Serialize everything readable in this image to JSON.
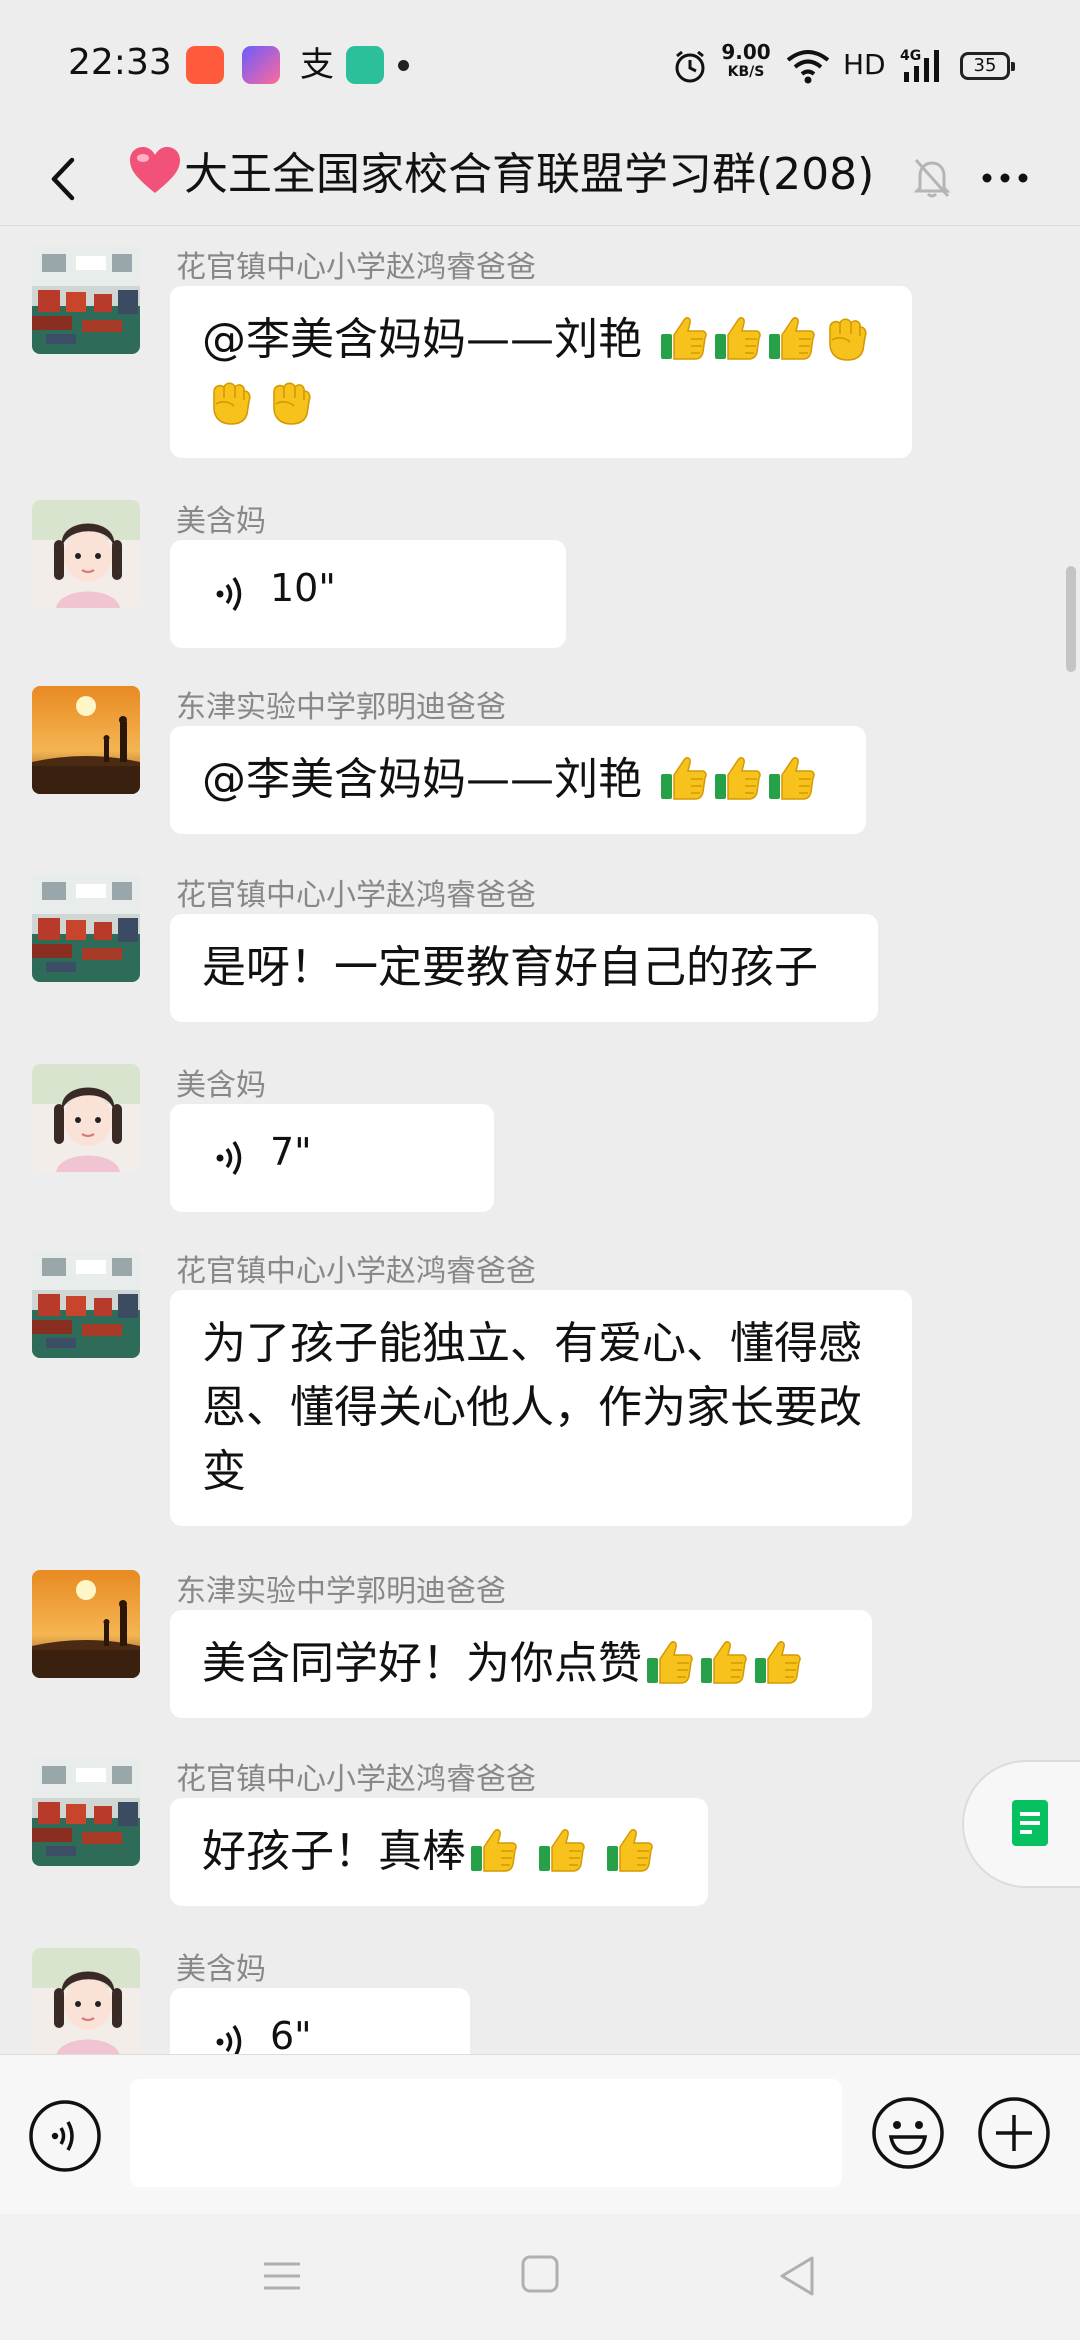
{
  "status_bar": {
    "time": "22:33",
    "net_speed": "9.00",
    "net_unit": "KB/S",
    "hd": "HD",
    "battery": "35"
  },
  "header": {
    "title": "大王全国家校合育联盟学习群(208)",
    "icons": [
      "back-icon",
      "heart-emoji",
      "mute-bell-icon",
      "more-icon"
    ]
  },
  "messages": [
    {
      "sender": "花官镇中心小学赵鸿睿爸爸",
      "avatar": "classroom",
      "line1": "@李美含妈妈——刘艳 ",
      "line2": ""
    },
    {
      "sender": "美含妈",
      "avatar": "girl",
      "voice": "10\""
    },
    {
      "sender": "东津实验中学郭明迪爸爸",
      "avatar": "sunset",
      "text": "@李美含妈妈——刘艳 "
    },
    {
      "sender": "花官镇中心小学赵鸿睿爸爸",
      "avatar": "classroom",
      "text": "是呀！一定要教育好自己的孩子"
    },
    {
      "sender": "美含妈",
      "avatar": "girl",
      "voice": "7\""
    },
    {
      "sender": "花官镇中心小学赵鸿睿爸爸",
      "avatar": "classroom",
      "text": "为了孩子能独立、有爱心、懂得感恩、懂得关心他人，作为家长要改变"
    },
    {
      "sender": "东津实验中学郭明迪爸爸",
      "avatar": "sunset",
      "text": "美含同学好！为你点赞"
    },
    {
      "sender": "花官镇中心小学赵鸿睿爸爸",
      "avatar": "classroom",
      "text": "好孩子！真棒"
    },
    {
      "sender": "美含妈",
      "avatar": "girl",
      "voice": "6\""
    }
  ],
  "colors": {
    "background": "#ededed",
    "bubble": "#ffffff",
    "sender": "#888888",
    "accent_green": "#07c160"
  },
  "input_bar": {
    "icons": [
      "voice-input-icon",
      "emoji-icon",
      "plus-icon"
    ],
    "placeholder": ""
  },
  "nav_bar": {
    "icons": [
      "menu-icon",
      "home-icon",
      "back-triangle-icon"
    ]
  }
}
